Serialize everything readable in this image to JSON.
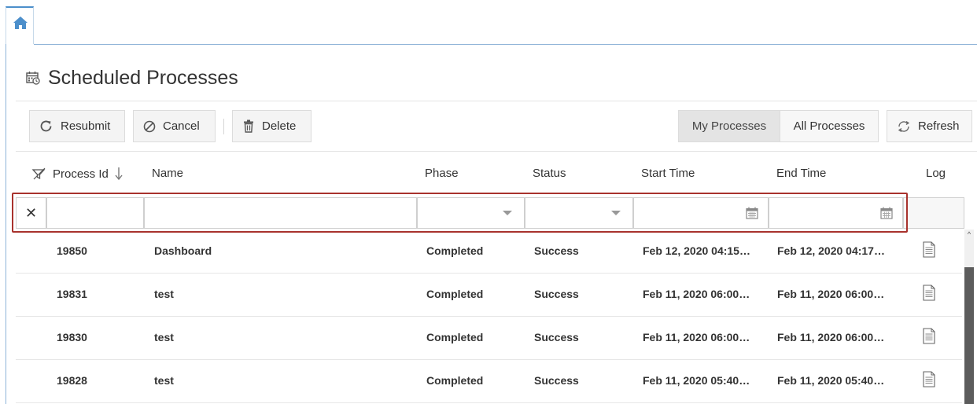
{
  "nav": {
    "home_icon": "home-icon"
  },
  "page": {
    "title": "Scheduled Processes",
    "title_icon": "calendar-clock-icon"
  },
  "toolbar": {
    "resubmit": "Resubmit",
    "cancel": "Cancel",
    "delete": "Delete",
    "my_processes": "My Processes",
    "all_processes": "All Processes",
    "refresh": "Refresh"
  },
  "table": {
    "columns": {
      "process_id": "Process Id",
      "name": "Name",
      "phase": "Phase",
      "status": "Status",
      "start_time": "Start Time",
      "end_time": "End Time",
      "log": "Log"
    },
    "filters": {
      "clear": "✕",
      "process_id": "",
      "name": "",
      "phase": "",
      "status": "",
      "start_time": "",
      "end_time": ""
    },
    "rows": [
      {
        "id": "19850",
        "name": "Dashboard",
        "phase": "Completed",
        "status": "Success",
        "start": "Feb 12, 2020 04:15…",
        "end": "Feb 12, 2020 04:17…"
      },
      {
        "id": "19831",
        "name": "test",
        "phase": "Completed",
        "status": "Success",
        "start": "Feb 11, 2020 06:00…",
        "end": "Feb 11, 2020 06:00…"
      },
      {
        "id": "19830",
        "name": "test",
        "phase": "Completed",
        "status": "Success",
        "start": "Feb 11, 2020 06:00…",
        "end": "Feb 11, 2020 06:00…"
      },
      {
        "id": "19828",
        "name": "test",
        "phase": "Completed",
        "status": "Success",
        "start": "Feb 11, 2020 05:40…",
        "end": "Feb 11, 2020 05:40…"
      }
    ]
  },
  "colors": {
    "accent": "#4c8fcb",
    "highlight": "#a8322d"
  }
}
